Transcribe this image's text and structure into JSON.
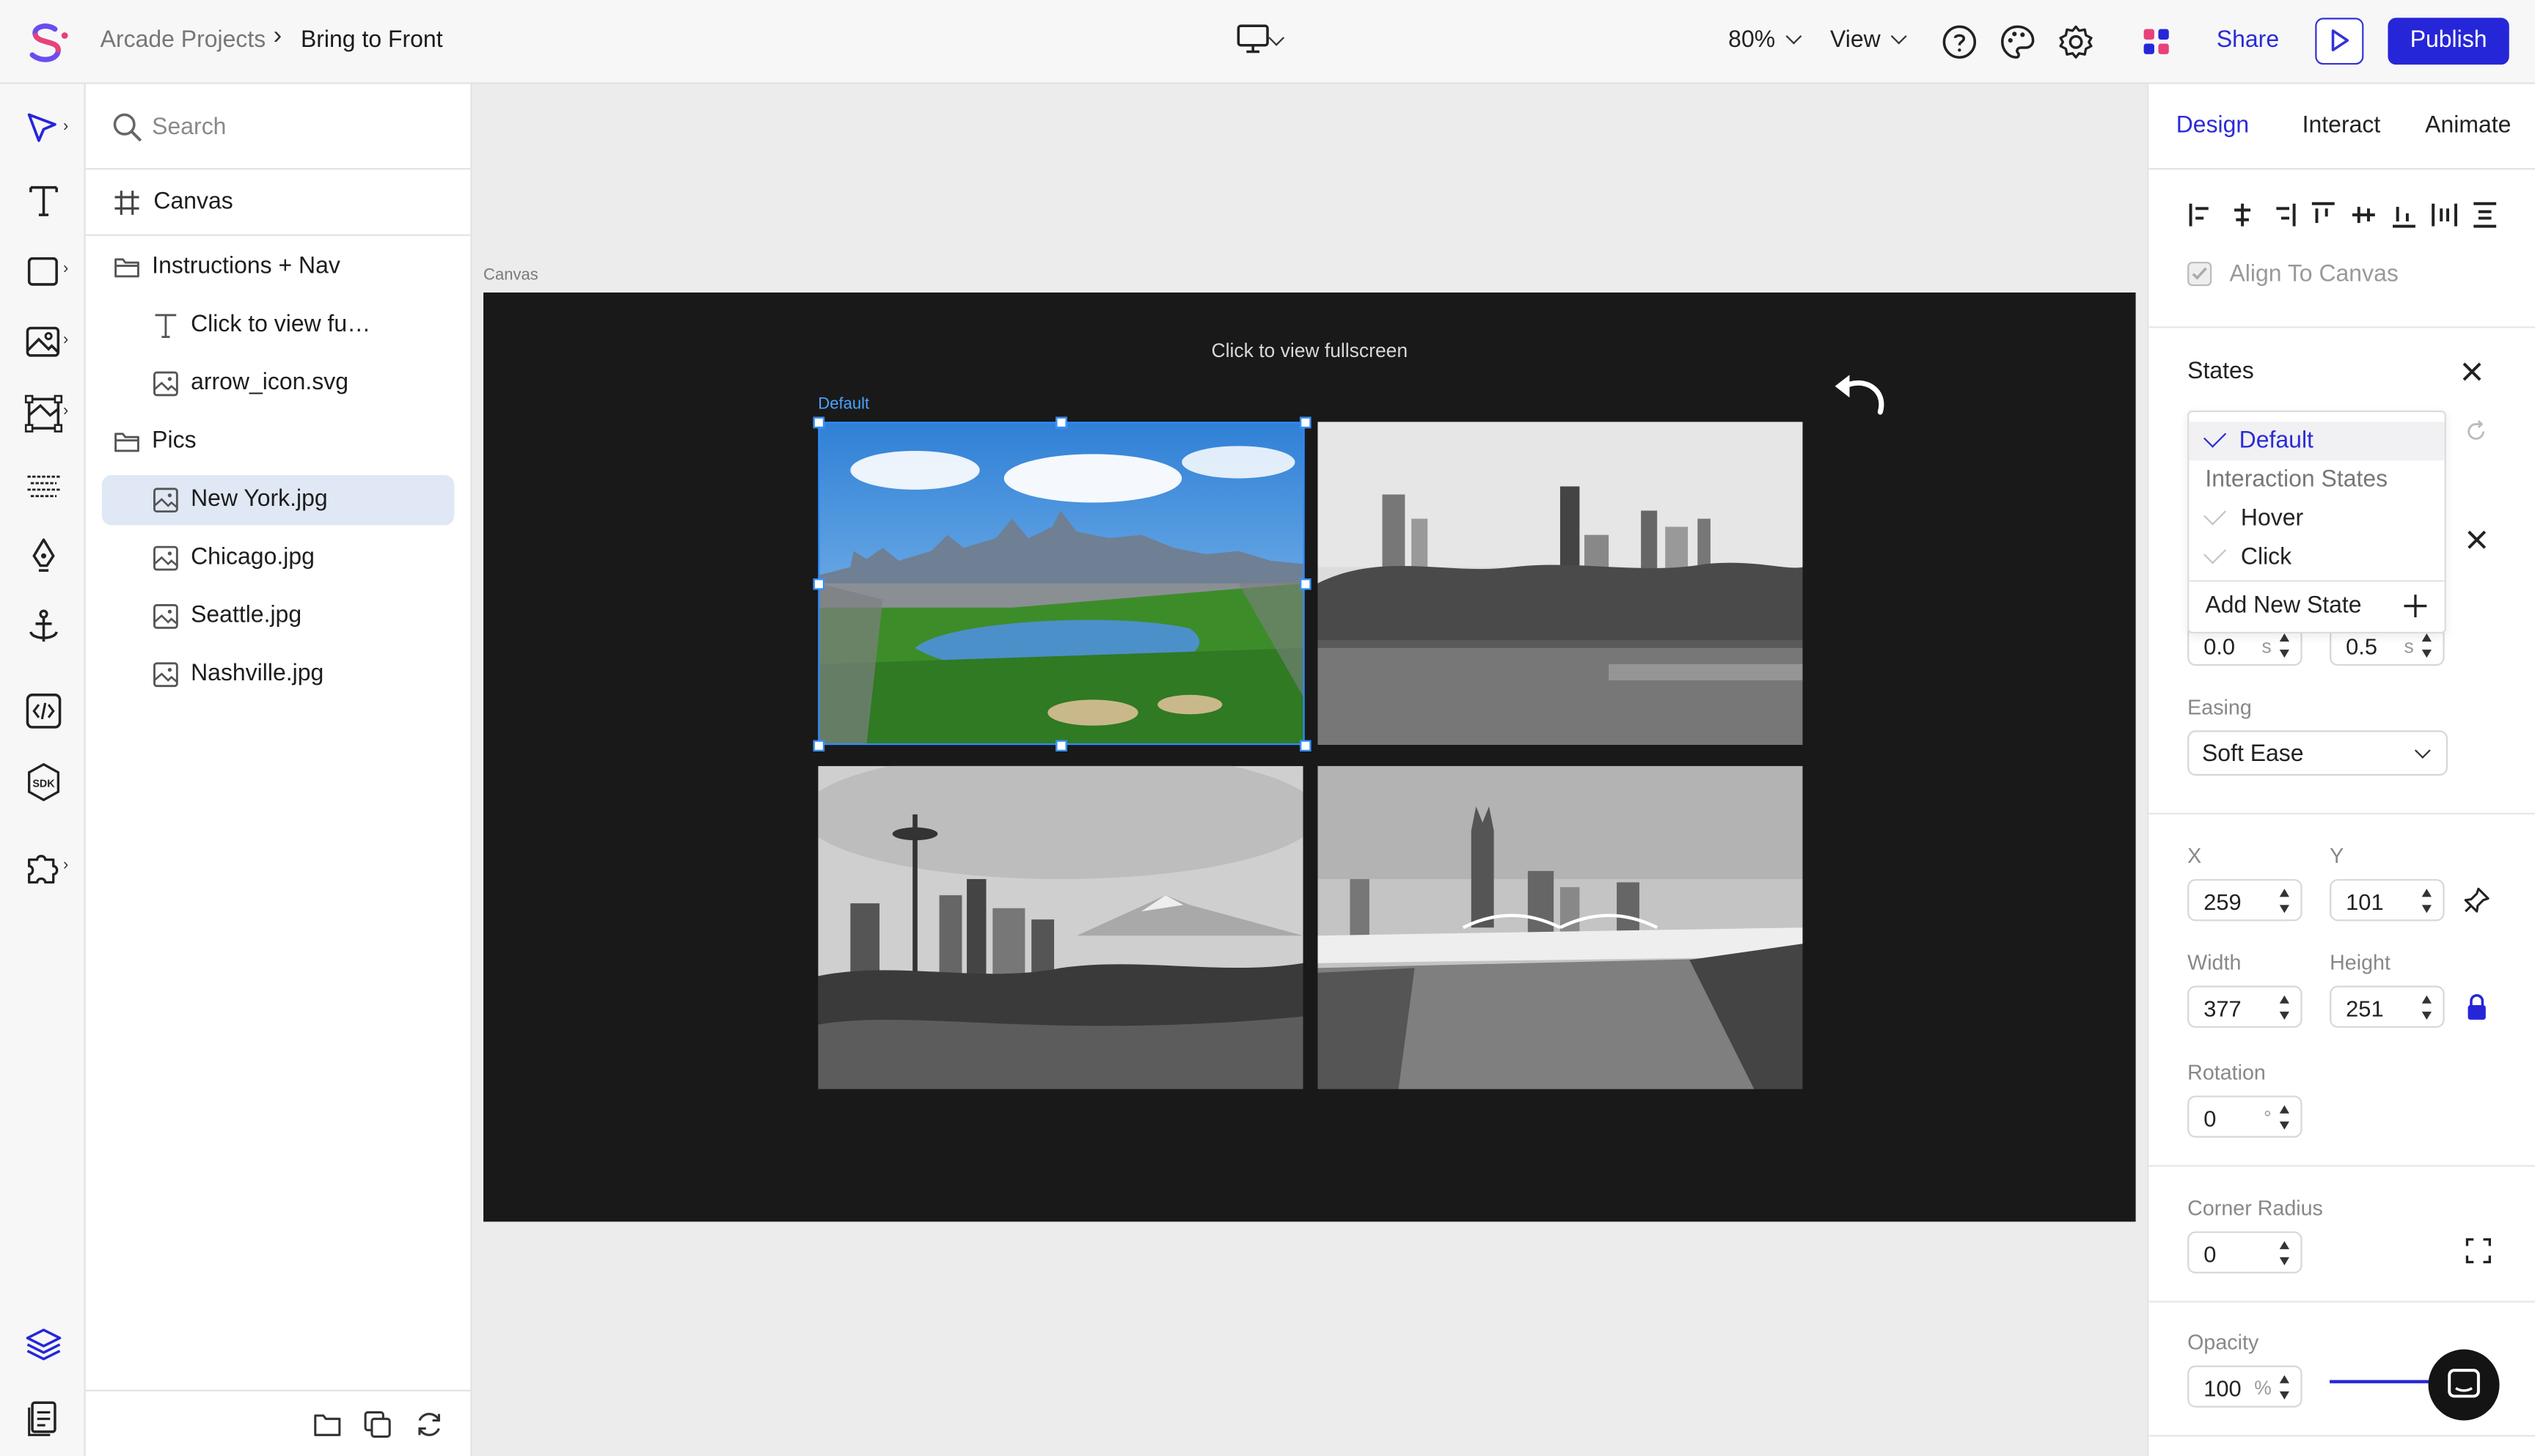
{
  "breadcrumb": {
    "parent": "Arcade Projects",
    "separator": "›",
    "current": "Bring to Front"
  },
  "topbar": {
    "zoom": "80%",
    "view": "View",
    "share": "Share",
    "publish": "Publish"
  },
  "layers": {
    "search_placeholder": "Search",
    "canvas": "Canvas",
    "items": [
      {
        "label": "Instructions + Nav",
        "icon": "folder-icon"
      },
      {
        "label": "Click to view fu…",
        "icon": "text-icon"
      },
      {
        "label": "arrow_icon.svg",
        "icon": "image-icon"
      },
      {
        "label": "Pics",
        "icon": "folder-icon"
      },
      {
        "label": "New York.jpg",
        "icon": "image-icon",
        "selected": true
      },
      {
        "label": "Chicago.jpg",
        "icon": "image-icon"
      },
      {
        "label": "Seattle.jpg",
        "icon": "image-icon"
      },
      {
        "label": "Nashville.jpg",
        "icon": "image-icon"
      }
    ]
  },
  "canvas": {
    "tag": "Canvas",
    "caption": "Click to view fullscreen",
    "state_tag": "Default"
  },
  "panel": {
    "tabs": [
      "Design",
      "Interact",
      "Animate"
    ],
    "active_tab": "Design",
    "align_to_canvas": "Align To Canvas",
    "states_title": "States",
    "states_menu": {
      "default": "Default",
      "interaction_heading": "Interaction States",
      "hover": "Hover",
      "click": "Click",
      "add": "Add New State"
    },
    "delay": {
      "value": "0.0",
      "unit": "s"
    },
    "duration": {
      "value": "0.5",
      "unit": "s"
    },
    "easing_label": "Easing",
    "easing_value": "Soft Ease",
    "x_label": "X",
    "x_value": "259",
    "y_label": "Y",
    "y_value": "101",
    "width_label": "Width",
    "width_value": "377",
    "height_label": "Height",
    "height_value": "251",
    "rotation_label": "Rotation",
    "rotation_value": "0",
    "rotation_unit": "°",
    "corner_label": "Corner Radius",
    "corner_value": "0",
    "opacity_label": "Opacity",
    "opacity_value": "100",
    "opacity_unit": "%"
  },
  "colors": {
    "accent": "#2626d9",
    "selection": "#2d8cff",
    "artboard": "#191919"
  }
}
